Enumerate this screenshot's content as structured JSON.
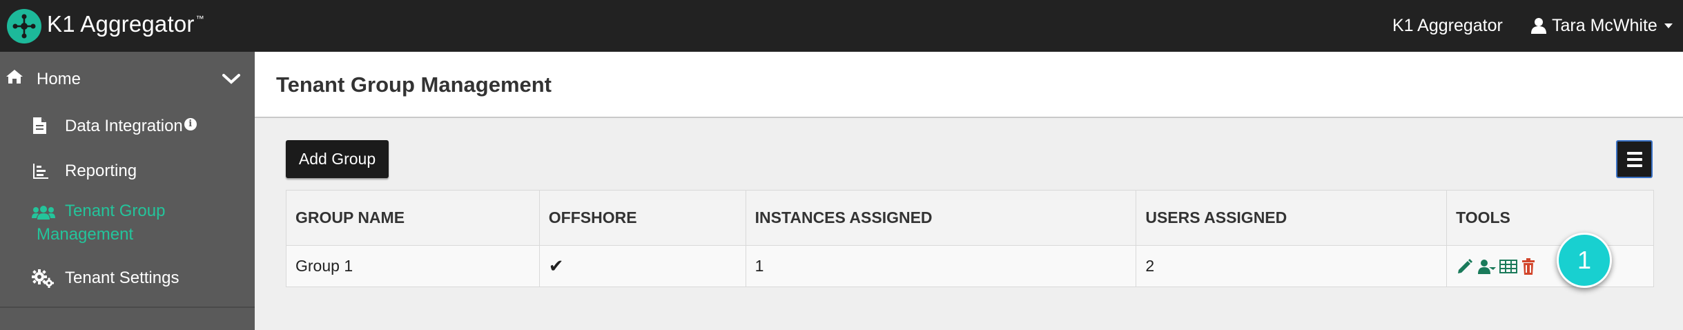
{
  "header": {
    "brand": "K1 Aggregator",
    "brand_tm": "™",
    "app_link": "K1 Aggregator",
    "user_name": "Tara McWhite"
  },
  "sidebar": {
    "home_label": "Home",
    "items": [
      {
        "label": "Data Integration",
        "icon": "document-icon",
        "badge": "i"
      },
      {
        "label": "Reporting",
        "icon": "reporting-icon"
      },
      {
        "label_line1": "Tenant Group",
        "label_line2": "Management",
        "icon": "users-icon",
        "active": true
      },
      {
        "label": "Tenant Settings",
        "icon": "gears-icon"
      }
    ]
  },
  "page": {
    "title": "Tenant Group Management",
    "add_button": "Add Group"
  },
  "table": {
    "columns": [
      "GROUP NAME",
      "OFFSHORE",
      "INSTANCES ASSIGNED",
      "USERS ASSIGNED",
      "TOOLS"
    ],
    "rows": [
      {
        "group_name": "Group 1",
        "offshore": "✔",
        "instances": "1",
        "users": "2"
      }
    ]
  },
  "annotation": {
    "label": "1"
  },
  "colors": {
    "topbar": "#222222",
    "sidebar": "#5a5a5a",
    "accent": "#24c49b",
    "bubble": "#18d0d0",
    "delete": "#d2452b"
  }
}
